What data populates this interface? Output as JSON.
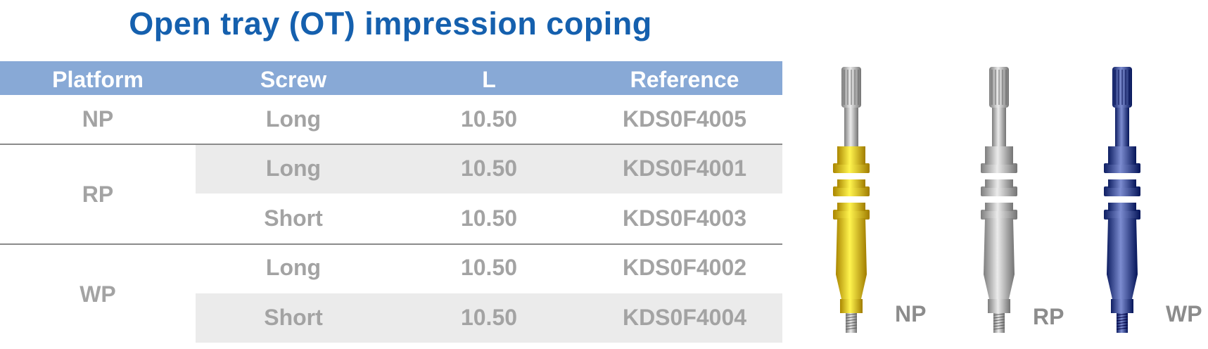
{
  "title": "Open tray (OT) impression coping",
  "table": {
    "headers": [
      "Platform",
      "Screw",
      "L",
      "Reference"
    ],
    "platforms": [
      "NP",
      "RP",
      "WP"
    ],
    "rows": [
      {
        "screw": "Long",
        "l": "10.50",
        "reference": "KDS0F4005"
      },
      {
        "screw": "Long",
        "l": "10.50",
        "reference": "KDS0F4001"
      },
      {
        "screw": "Short",
        "l": "10.50",
        "reference": "KDS0F4003"
      },
      {
        "screw": "Long",
        "l": "10.50",
        "reference": "KDS0F4002"
      },
      {
        "screw": "Short",
        "l": "10.50",
        "reference": "KDS0F4004"
      }
    ]
  },
  "images": [
    {
      "label": "NP",
      "color": "#e6c21c"
    },
    {
      "label": "RP",
      "color": "#b9b9b9"
    },
    {
      "label": "WP",
      "color": "#4a5a9e"
    }
  ],
  "colors": {
    "title": "#1560ae",
    "header_bg": "#88a9d6",
    "band_bg": "#ebebeb",
    "cell_text": "#a3a3a3"
  }
}
